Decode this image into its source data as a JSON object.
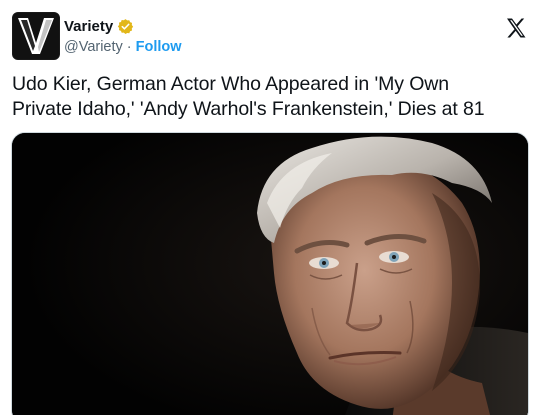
{
  "account": {
    "display_name": "Variety",
    "handle": "@Variety",
    "separator": "·",
    "follow_label": "Follow",
    "verified": true,
    "avatar_icon": "variety-v-logo-icon"
  },
  "platform": {
    "logo_icon": "x-logo-icon"
  },
  "tweet": {
    "line1": "Udo Kier, German Actor Who Appeared in 'My Own",
    "line2": "Private Idaho,' 'Andy Warhol's Frankenstein,' Dies at 81"
  },
  "media": {
    "kind": "photo",
    "subject": "portrait-photo"
  },
  "colors": {
    "link": "#1d9bf0",
    "verified_badge": "#e2b719",
    "text": "#0f1419",
    "secondary": "#536471"
  }
}
